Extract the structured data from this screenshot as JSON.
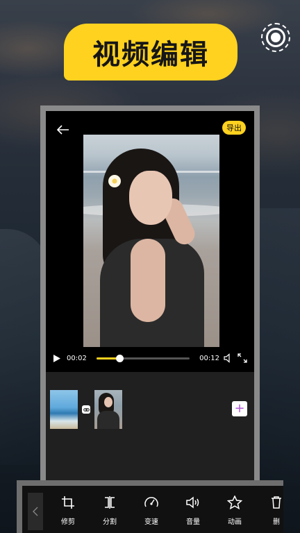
{
  "banner": {
    "title": "视频编辑"
  },
  "editor": {
    "export_label": "导出",
    "player": {
      "current_time": "00:02",
      "total_time": "00:12",
      "progress": 0.25
    }
  },
  "toolbar": {
    "tools": [
      {
        "label": "修剪",
        "icon": "crop-icon"
      },
      {
        "label": "分割",
        "icon": "split-icon"
      },
      {
        "label": "变速",
        "icon": "speed-icon"
      },
      {
        "label": "音量",
        "icon": "volume-icon"
      },
      {
        "label": "动画",
        "icon": "star-icon"
      },
      {
        "label": "删",
        "icon": "delete-icon"
      }
    ]
  },
  "colors": {
    "accent": "#ffd21f",
    "add_plus": "#b25ad6"
  }
}
